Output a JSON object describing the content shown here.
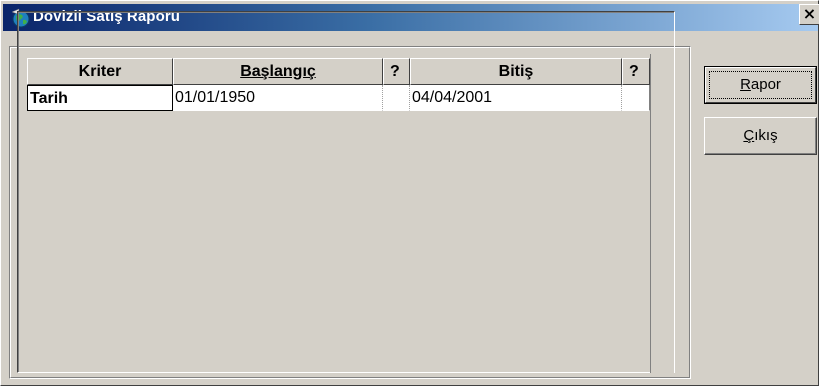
{
  "window": {
    "title": "Dövizli Satış Raporu",
    "close_label": "×"
  },
  "grid": {
    "columns": [
      {
        "label": "Kriter"
      },
      {
        "label": "Başlangıç"
      },
      {
        "label": "?"
      },
      {
        "label": "Bitiş"
      },
      {
        "label": "?"
      }
    ],
    "rows": [
      {
        "kriter": "Tarih",
        "baslangic": "01/01/1950",
        "bitis": "04/04/2001"
      }
    ]
  },
  "buttons": {
    "rapor": {
      "mnemonic": "R",
      "rest": "apor"
    },
    "cikis": {
      "mnemonic": "Ç",
      "pre": "",
      "rest": "ıkış"
    }
  },
  "colors": {
    "titlebar_start": "#0a246a",
    "titlebar_end": "#a6caf0",
    "face": "#d4d0c8"
  }
}
